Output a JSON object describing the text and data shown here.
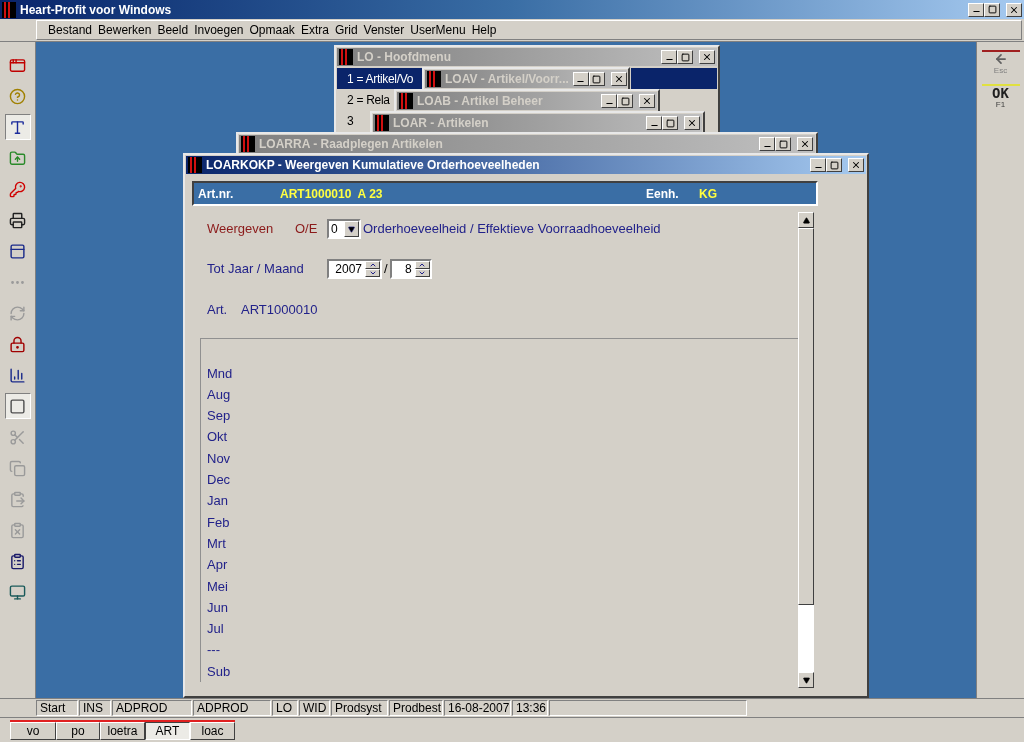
{
  "app_title": "Heart-Profit voor Windows",
  "menu": [
    "Bestand",
    "Bewerken",
    "Beeld",
    "Invoegen",
    "Opmaak",
    "Extra",
    "Grid",
    "Venster",
    "UserMenu",
    "Help"
  ],
  "toolbar_buttons": [
    {
      "disabled": false,
      "pressed": false
    },
    {
      "disabled": false,
      "pressed": false
    },
    {
      "disabled": false,
      "pressed": true
    },
    {
      "disabled": false,
      "pressed": false
    },
    {
      "disabled": false,
      "pressed": false
    },
    {
      "disabled": false,
      "pressed": false
    },
    {
      "disabled": false,
      "pressed": false
    },
    {
      "disabled": true,
      "pressed": false
    },
    {
      "disabled": true,
      "pressed": false
    },
    {
      "disabled": false,
      "pressed": false
    },
    {
      "disabled": false,
      "pressed": false
    },
    {
      "disabled": false,
      "pressed": true
    },
    {
      "disabled": true,
      "pressed": false
    },
    {
      "disabled": true,
      "pressed": false
    },
    {
      "disabled": true,
      "pressed": false
    },
    {
      "disabled": true,
      "pressed": false
    },
    {
      "disabled": false,
      "pressed": false
    },
    {
      "disabled": false,
      "pressed": false
    }
  ],
  "right_toolbar": [
    {
      "kind": "back",
      "key": "Esc"
    },
    {
      "kind": "ok",
      "label": "OK",
      "key": "F1"
    }
  ],
  "windows": [
    {
      "title": "LO - Hoofdmenu",
      "active": false,
      "rows": [
        {
          "label": "1 = Artikel/Vo",
          "selected": true
        },
        {
          "label": "2 = Rela",
          "selected": false
        },
        {
          "label": "3",
          "selected": false
        }
      ]
    },
    {
      "title": "LOAV - Artikel/Voorr...",
      "active": false
    },
    {
      "title": "LOAB - Artikel Beheer",
      "active": false
    },
    {
      "title": "LOAR - Artikelen",
      "active": false
    },
    {
      "title": "LOARRA - Raadplegen Artikelen",
      "active": false
    },
    {
      "title": "LOARKOKP - Weergeven Kumulatieve Orderhoeveelheden",
      "active": true
    }
  ],
  "main": {
    "header": {
      "art_label": "Art.nr.",
      "art_value": "ART1000010  A 23",
      "unit_label": "Eenh.",
      "unit_value": "KG"
    },
    "display": {
      "label": "Weergeven",
      "code_label": "O/E",
      "value": "0",
      "description": "Orderhoeveelheid / Effektieve Voorraadhoeveelheid"
    },
    "period": {
      "label": "Tot Jaar / Maand",
      "year": "2007",
      "separator": "/",
      "month": "8"
    },
    "article": {
      "label": "Art.",
      "value": "ART1000010"
    },
    "months": [
      "Mnd",
      "Aug",
      "Sep",
      "Okt",
      "Nov",
      "Dec",
      "Jan",
      "Feb",
      "Mrt",
      "Apr",
      "Mei",
      "Jun",
      "Jul",
      "---",
      "Sub"
    ]
  },
  "status_bar": [
    "Start",
    "INS",
    "ADPROD",
    "ADPROD",
    "LO",
    "WID",
    "Prodsyst",
    "Prodbest",
    "16-08-2007",
    "13:36"
  ],
  "tabs": [
    {
      "label": "vo",
      "selected": false
    },
    {
      "label": "po",
      "selected": false
    },
    {
      "label": "loetra",
      "selected": false
    },
    {
      "label": "ART",
      "selected": true
    },
    {
      "label": "loac",
      "selected": false
    }
  ]
}
